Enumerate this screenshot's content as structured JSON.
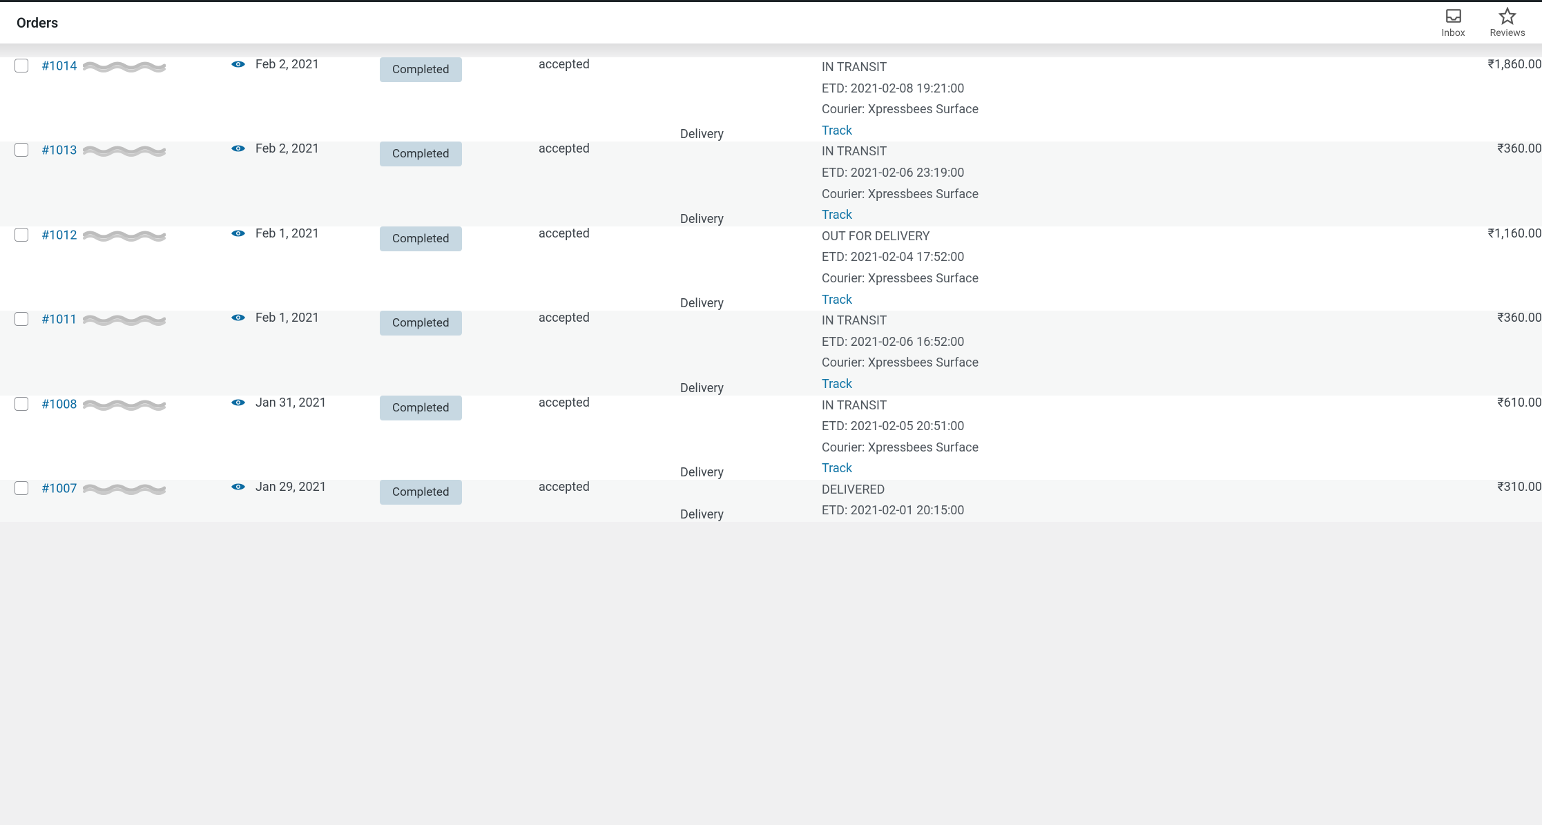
{
  "header": {
    "title": "Orders",
    "inbox_label": "Inbox",
    "reviews_label": "Reviews"
  },
  "orders": [
    {
      "id_label": "#1014",
      "date": "Feb 2, 2021",
      "status": "Completed",
      "payment": "accepted",
      "mode": "Delivery",
      "ship_status": "IN TRANSIT",
      "etd": "ETD: 2021-02-08 19:21:00",
      "courier": "Courier: Xpressbees Surface",
      "track": "Track",
      "total": "₹1,860.00"
    },
    {
      "id_label": "#1013",
      "date": "Feb 2, 2021",
      "status": "Completed",
      "payment": "accepted",
      "mode": "Delivery",
      "ship_status": "IN TRANSIT",
      "etd": "ETD: 2021-02-06 23:19:00",
      "courier": "Courier: Xpressbees Surface",
      "track": "Track",
      "total": "₹360.00"
    },
    {
      "id_label": "#1012",
      "date": "Feb 1, 2021",
      "status": "Completed",
      "payment": "accepted",
      "mode": "Delivery",
      "ship_status": "OUT FOR DELIVERY",
      "etd": "ETD: 2021-02-04 17:52:00",
      "courier": "Courier: Xpressbees Surface",
      "track": "Track",
      "total": "₹1,160.00"
    },
    {
      "id_label": "#1011",
      "date": "Feb 1, 2021",
      "status": "Completed",
      "payment": "accepted",
      "mode": "Delivery",
      "ship_status": "IN TRANSIT",
      "etd": "ETD: 2021-02-06 16:52:00",
      "courier": "Courier: Xpressbees Surface",
      "track": "Track",
      "total": "₹360.00"
    },
    {
      "id_label": "#1008",
      "date": "Jan 31, 2021",
      "status": "Completed",
      "payment": "accepted",
      "mode": "Delivery",
      "ship_status": "IN TRANSIT",
      "etd": "ETD: 2021-02-05 20:51:00",
      "courier": "Courier: Xpressbees Surface",
      "track": "Track",
      "total": "₹610.00"
    },
    {
      "id_label": "#1007",
      "date": "Jan 29, 2021",
      "status": "Completed",
      "payment": "accepted",
      "mode": "Delivery",
      "ship_status": "DELIVERED",
      "etd": "ETD: 2021-02-01 20:15:00",
      "courier": "",
      "track": "",
      "total": "₹310.00"
    }
  ]
}
